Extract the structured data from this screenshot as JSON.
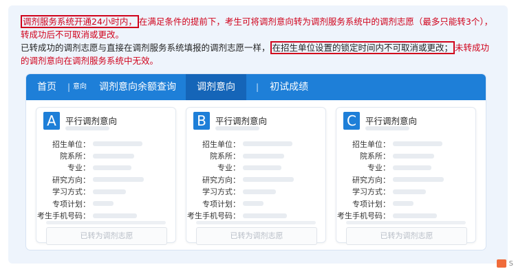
{
  "notice": {
    "boxed_red": "调剂服务系统开通24小时内，",
    "red_rest": "在满足条件的提前下，考生可将调剂意向转为调剂服务系统中的调剂志愿（最多只能转3个），转成功后不可取消或更改。",
    "dark_part": "已转成功的调剂志愿与直接在调剂服务系统填报的调剂志愿一样，",
    "boxed_dark": "在招生单位设置的锁定时间内不可取消或更改；",
    "red_end": "未转成功的调剂意向在调剂服务系统中无效。"
  },
  "nav": {
    "home": "首页",
    "sep": "|",
    "intent_small": "意向",
    "quota": "调剂意向余额查询",
    "intent": "调剂意向",
    "score": "初试成绩"
  },
  "cards": [
    {
      "letter": "A",
      "title": "平行调剂意向",
      "button": "已转为调剂志愿"
    },
    {
      "letter": "B",
      "title": "平行调剂意向",
      "button": "已转为调剂志愿"
    },
    {
      "letter": "C",
      "title": "平行调剂意向",
      "button": "已转为调剂志愿"
    }
  ],
  "field_labels": [
    "招生单位：",
    "院系所：",
    "专业：",
    "研究方向：",
    "学习方式：",
    "专项计划：",
    "考生手机号码："
  ],
  "corner_text": "S",
  "colors": {
    "accent": "#1e7fd8",
    "accent_dark": "#1565b8",
    "alert": "#d0021b"
  }
}
